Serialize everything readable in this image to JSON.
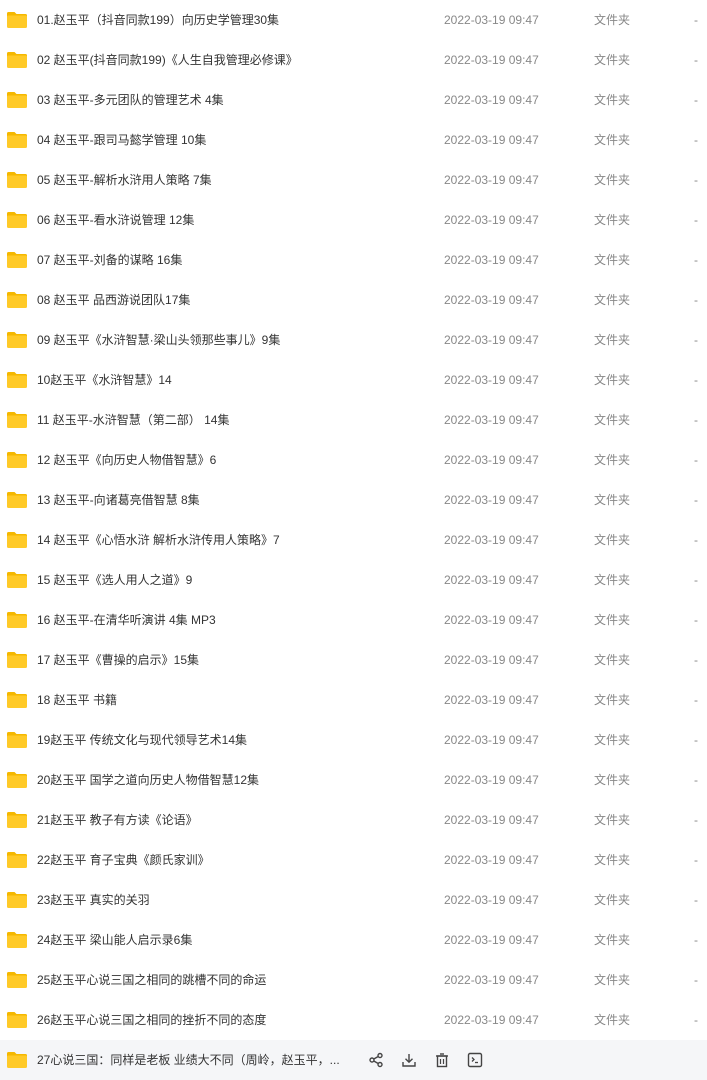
{
  "files": [
    {
      "name": "01.赵玉平（抖音同款199）向历史学管理30集",
      "date": "2022-03-19 09:47",
      "type": "文件夹",
      "size": "-"
    },
    {
      "name": "02 赵玉平(抖音同款199)《人生自我管理必修课》",
      "date": "2022-03-19 09:47",
      "type": "文件夹",
      "size": "-"
    },
    {
      "name": "03  赵玉平-多元团队的管理艺术 4集",
      "date": "2022-03-19 09:47",
      "type": "文件夹",
      "size": "-"
    },
    {
      "name": "04  赵玉平-跟司马懿学管理 10集",
      "date": "2022-03-19 09:47",
      "type": "文件夹",
      "size": "-"
    },
    {
      "name": "05  赵玉平-解析水浒用人策略 7集",
      "date": "2022-03-19 09:47",
      "type": "文件夹",
      "size": "-"
    },
    {
      "name": "06  赵玉平-看水浒说管理 12集",
      "date": "2022-03-19 09:47",
      "type": "文件夹",
      "size": "-"
    },
    {
      "name": "07  赵玉平-刘备的谋略 16集",
      "date": "2022-03-19 09:47",
      "type": "文件夹",
      "size": "-"
    },
    {
      "name": "08 赵玉平 品西游说团队17集",
      "date": "2022-03-19 09:47",
      "type": "文件夹",
      "size": "-"
    },
    {
      "name": "09 赵玉平《水浒智慧·梁山头领那些事儿》9集",
      "date": "2022-03-19 09:47",
      "type": "文件夹",
      "size": "-"
    },
    {
      "name": "10赵玉平《水浒智慧》14",
      "date": "2022-03-19 09:47",
      "type": "文件夹",
      "size": "-"
    },
    {
      "name": "11  赵玉平-水浒智慧（第二部） 14集",
      "date": "2022-03-19 09:47",
      "type": "文件夹",
      "size": "-"
    },
    {
      "name": "12 赵玉平《向历史人物借智慧》6",
      "date": "2022-03-19 09:47",
      "type": "文件夹",
      "size": "-"
    },
    {
      "name": "13  赵玉平-向诸葛亮借智慧 8集",
      "date": "2022-03-19 09:47",
      "type": "文件夹",
      "size": "-"
    },
    {
      "name": "14 赵玉平《心悟水浒 解析水浒传用人策略》7",
      "date": "2022-03-19 09:47",
      "type": "文件夹",
      "size": "-"
    },
    {
      "name": "15 赵玉平《选人用人之道》9",
      "date": "2022-03-19 09:47",
      "type": "文件夹",
      "size": "-"
    },
    {
      "name": "16 赵玉平-在清华听演讲 4集 MP3",
      "date": "2022-03-19 09:47",
      "type": "文件夹",
      "size": "-"
    },
    {
      "name": "17 赵玉平《曹操的启示》15集",
      "date": "2022-03-19 09:47",
      "type": "文件夹",
      "size": "-"
    },
    {
      "name": "18  赵玉平 书籍",
      "date": "2022-03-19 09:47",
      "type": "文件夹",
      "size": "-"
    },
    {
      "name": "19赵玉平 传统文化与现代领导艺术14集",
      "date": "2022-03-19 09:47",
      "type": "文件夹",
      "size": "-"
    },
    {
      "name": "20赵玉平 国学之道向历史人物借智慧12集",
      "date": "2022-03-19 09:47",
      "type": "文件夹",
      "size": "-"
    },
    {
      "name": "21赵玉平 教子有方读《论语》",
      "date": "2022-03-19 09:47",
      "type": "文件夹",
      "size": "-"
    },
    {
      "name": "22赵玉平 育子宝典《颜氏家训》",
      "date": "2022-03-19 09:47",
      "type": "文件夹",
      "size": "-"
    },
    {
      "name": "23赵玉平 真实的关羽",
      "date": "2022-03-19 09:47",
      "type": "文件夹",
      "size": "-"
    },
    {
      "name": "24赵玉平 梁山能人启示录6集",
      "date": "2022-03-19 09:47",
      "type": "文件夹",
      "size": "-"
    },
    {
      "name": "25赵玉平心说三国之相同的跳槽不同的命运",
      "date": "2022-03-19 09:47",
      "type": "文件夹",
      "size": "-"
    },
    {
      "name": "26赵玉平心说三国之相同的挫折不同的态度",
      "date": "2022-03-19 09:47",
      "type": "文件夹",
      "size": "-"
    }
  ],
  "hovered_row": {
    "name": "27心说三国：同样是老板 业绩大不同（周岭，赵玉平，...",
    "actions": [
      "share-icon",
      "download-icon",
      "delete-icon",
      "more-icon"
    ]
  },
  "colors": {
    "folder": "#FFCA28",
    "folder_tab": "#F5B800",
    "hover_bg": "#f5f6f8",
    "icon": "#444444"
  }
}
